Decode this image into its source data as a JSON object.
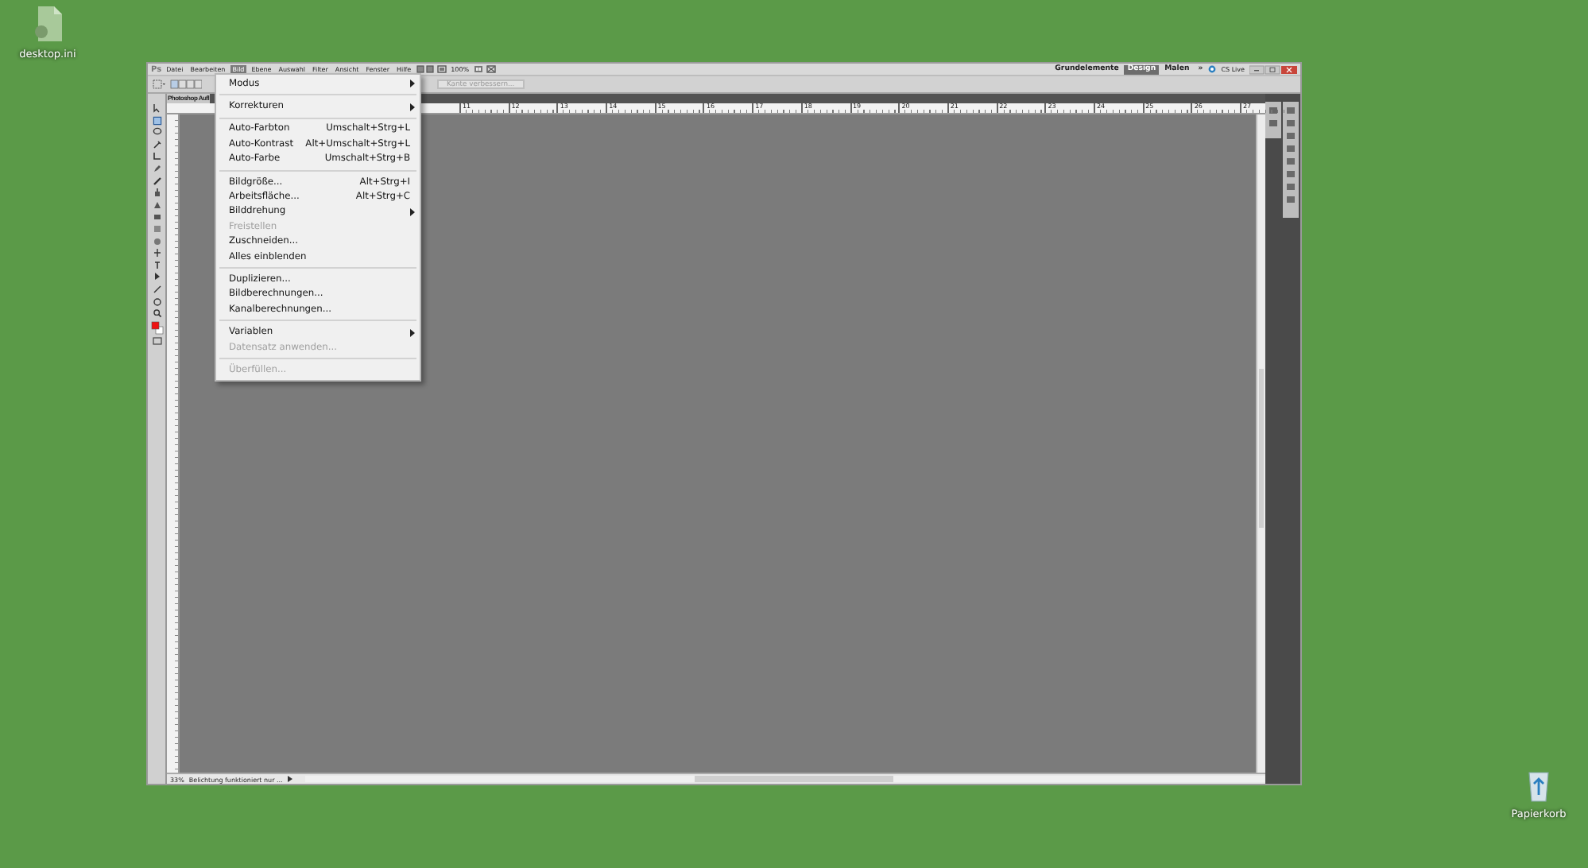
{
  "desktop_icons": [
    {
      "label": "desktop.ini",
      "kind": "file"
    },
    {
      "label": "Papierkorb",
      "kind": "recycle"
    }
  ],
  "window": {
    "logo": "Ps",
    "menus": [
      {
        "label": "Datei",
        "selected": false
      },
      {
        "label": "Bearbeiten",
        "selected": false
      },
      {
        "label": "Bild",
        "selected": true
      },
      {
        "label": "Ebene",
        "selected": false
      },
      {
        "label": "Auswahl",
        "selected": false
      },
      {
        "label": "Filter",
        "selected": false
      },
      {
        "label": "Ansicht",
        "selected": false
      },
      {
        "label": "Fenster",
        "selected": false
      },
      {
        "label": "Hilfe",
        "selected": false
      }
    ],
    "zoom": "100%",
    "workspaces": [
      {
        "label": "Grundelemente",
        "selected": false
      },
      {
        "label": "Design",
        "selected": true
      },
      {
        "label": "Malen",
        "selected": false
      },
      {
        "label": "»",
        "selected": false
      }
    ],
    "cs_live": "CS Live",
    "refine_edge": "Kante verbessern...",
    "document_tab": "Photoshop Aufl",
    "ruler_labels": [
      "11",
      "12",
      "13",
      "14",
      "15",
      "16",
      "17",
      "18",
      "19",
      "20",
      "21",
      "22",
      "23",
      "24",
      "25",
      "26",
      "27"
    ],
    "status_zoom": "33%",
    "status_text": "Belichtung funktioniert nur ..."
  },
  "menu": {
    "groups": [
      [
        {
          "label": "Modus",
          "submenu": true,
          "disabled": false
        }
      ],
      [
        {
          "label": "Korrekturen",
          "submenu": true,
          "disabled": false
        }
      ],
      [
        {
          "label": "Auto-Farbton",
          "shortcut": "Umschalt+Strg+L",
          "submenu": false,
          "disabled": false
        },
        {
          "label": "Auto-Kontrast",
          "shortcut": "Alt+Umschalt+Strg+L",
          "submenu": false,
          "disabled": false
        },
        {
          "label": "Auto-Farbe",
          "shortcut": "Umschalt+Strg+B",
          "submenu": false,
          "disabled": false
        }
      ],
      [
        {
          "label": "Bildgröße...",
          "shortcut": "Alt+Strg+I",
          "submenu": false,
          "disabled": false
        },
        {
          "label": "Arbeitsfläche...",
          "shortcut": "Alt+Strg+C",
          "submenu": false,
          "disabled": false
        },
        {
          "label": "Bilddrehung",
          "submenu": true,
          "disabled": false
        },
        {
          "label": "Freistellen",
          "submenu": false,
          "disabled": true
        },
        {
          "label": "Zuschneiden...",
          "submenu": false,
          "disabled": false
        },
        {
          "label": "Alles einblenden",
          "submenu": false,
          "disabled": false
        }
      ],
      [
        {
          "label": "Duplizieren...",
          "submenu": false,
          "disabled": false
        },
        {
          "label": "Bildberechnungen...",
          "submenu": false,
          "disabled": false
        },
        {
          "label": "Kanalberechnungen...",
          "submenu": false,
          "disabled": false
        }
      ],
      [
        {
          "label": "Variablen",
          "submenu": true,
          "disabled": false
        },
        {
          "label": "Datensatz anwenden...",
          "submenu": false,
          "disabled": true
        }
      ],
      [
        {
          "label": "Überfüllen...",
          "submenu": false,
          "disabled": true
        }
      ]
    ]
  }
}
